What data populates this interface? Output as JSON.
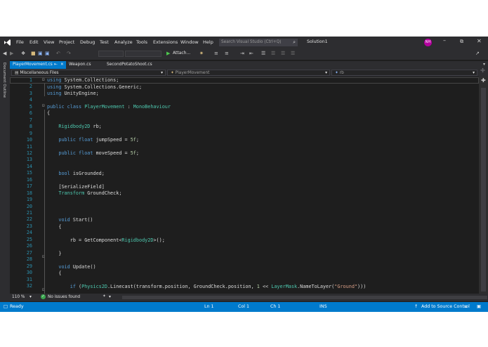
{
  "menu": [
    "File",
    "Edit",
    "View",
    "Project",
    "Debug",
    "Test",
    "Analyze",
    "Tools",
    "Extensions",
    "Window",
    "Help"
  ],
  "search": {
    "placeholder": "Search Visual Studio (Ctrl+Q)"
  },
  "solution_name": "Solution1",
  "user_initials": "NH",
  "toolbar": {
    "attach_label": "Attach..."
  },
  "tabs": [
    {
      "label": "PlayerMovement.cs",
      "active": true
    },
    {
      "label": "Weapon.cs"
    },
    {
      "label": "SecondPotatoShoot.cs"
    }
  ],
  "side_panel": {
    "label": "Document Outline"
  },
  "nav": {
    "project": "Miscellaneous Files",
    "type": "PlayerMovement",
    "member": "rb"
  },
  "code_lines": [
    {
      "n": "1"
    },
    {
      "n": "2"
    },
    {
      "n": "3"
    },
    {
      "n": "4"
    },
    {
      "n": "5"
    },
    {
      "n": "6"
    },
    {
      "n": "7"
    },
    {
      "n": "8"
    },
    {
      "n": "9"
    },
    {
      "n": "10"
    },
    {
      "n": "11"
    },
    {
      "n": "12"
    },
    {
      "n": "13"
    },
    {
      "n": "14"
    },
    {
      "n": "15"
    },
    {
      "n": "16"
    },
    {
      "n": "17"
    },
    {
      "n": "18"
    },
    {
      "n": "19"
    },
    {
      "n": "20"
    },
    {
      "n": "21"
    },
    {
      "n": "22"
    },
    {
      "n": "23"
    },
    {
      "n": "24"
    },
    {
      "n": "25"
    },
    {
      "n": "26"
    },
    {
      "n": "27"
    },
    {
      "n": "28"
    },
    {
      "n": "29"
    },
    {
      "n": "30"
    },
    {
      "n": "31"
    },
    {
      "n": "32"
    }
  ],
  "code": {
    "l1_kw": "using",
    "l1_rest": " System.Collections;",
    "l2_kw": "using",
    "l2_rest": " System.Collections.Generic;",
    "l3_kw": "using",
    "l3_rest": " UnityEngine;",
    "l5_kw": "public class",
    "l5_name": "PlayerMovement",
    "l5_sep": " : ",
    "l5_base": "MonoBehaviour",
    "l6": "{",
    "l8_type": "Rigidbody2D",
    "l8_rest": " rb;",
    "l10_kw": "public float",
    "l10_rest": " jumpSpeed = ",
    "l10_num": "5f",
    "l10_end": ";",
    "l12_kw": "public float",
    "l12_rest": " moveSpeed = ",
    "l12_num": "5f",
    "l12_end": ";",
    "l15_kw": "bool",
    "l15_rest": " isGrounded;",
    "l17": "[SerializeField]",
    "l18_type": "Transform",
    "l18_rest": " GroundCheck;",
    "l22_kw": "void",
    "l22_rest": " Start()",
    "l23": "{",
    "l25_a": "rb = GetComponent<",
    "l25_type": "Rigidbody2D",
    "l25_b": ">();",
    "l27": "}",
    "l29_kw": "void",
    "l29_rest": " Update()",
    "l30": "{",
    "l32_kw": "if",
    "l32_a": " (",
    "l32_t1": "Physics2D",
    "l32_b": ".Linecast(transform.position, GroundCheck.position, ",
    "l32_n1": "1",
    "l32_c": " << ",
    "l32_t2": "LayerMask",
    "l32_d": ".NameToLayer(",
    "l32_str": "\"Ground\"",
    "l32_e": ")))"
  },
  "info": {
    "zoom": "110 %",
    "issues": "No issues found"
  },
  "status": {
    "ready": "Ready",
    "ln": "Ln 1",
    "col": "Col 1",
    "ch": "Ch 1",
    "ins": "INS",
    "source_control": "Add to Source Control"
  },
  "colors": {
    "accent": "#007acc",
    "chrome": "#2d2d30",
    "editor_bg": "#1e1e1e",
    "keyword": "#569cd6",
    "type": "#4ec9b0",
    "line_number": "#2b91af",
    "avatar": "#b4009e"
  }
}
